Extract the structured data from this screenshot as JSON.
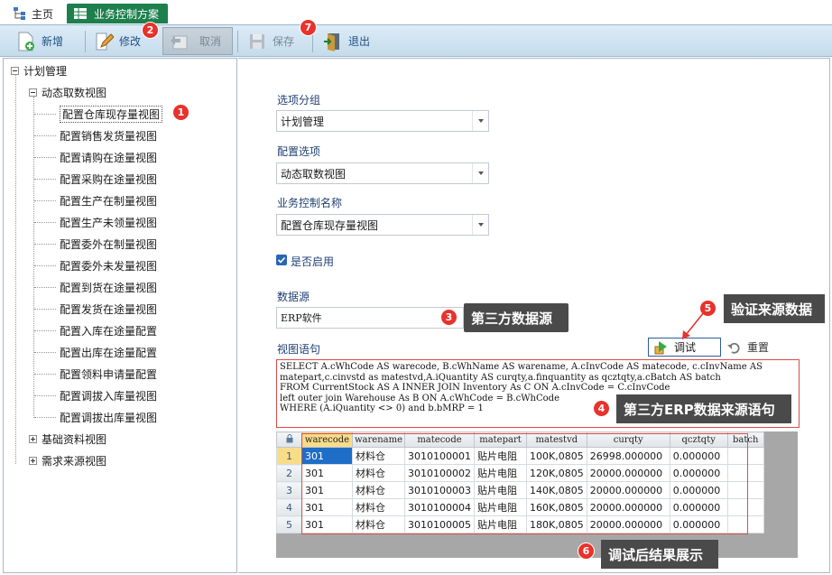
{
  "tabs": [
    {
      "label": "主页",
      "icon": "sitemap-icon"
    },
    {
      "label": "业务控制方案",
      "icon": "table-icon"
    }
  ],
  "toolbar": {
    "add": "新增",
    "edit": "修改",
    "cancel": "取消",
    "save": "保存",
    "exit": "退出"
  },
  "tree": {
    "root": "计划管理",
    "group": "动态取数视图",
    "items": [
      "配置仓库现存量视图",
      "配置销售发货量视图",
      "配置请购在途量视图",
      "配置采购在途量视图",
      "配置生产在制量视图",
      "配置生产未领量视图",
      "配置委外在制量视图",
      "配置委外未发量视图",
      "配置到货在途量视图",
      "配置发货在途量视图",
      "配置入库在途量配置",
      "配置出库在途量配置",
      "配置领料申请量配置",
      "配置调拔入库量视图",
      "配置调拔出库量视图"
    ],
    "others": [
      "基础资料视图",
      "需求来源视图"
    ]
  },
  "form": {
    "option_group_label": "选项分组",
    "option_group_value": "计划管理",
    "config_option_label": "配置选项",
    "config_option_value": "动态取数视图",
    "biz_name_label": "业务控制名称",
    "biz_name_value": "配置仓库现存量视图",
    "enabled_label": "是否启用",
    "datasource_label": "数据源",
    "datasource_value": "ERP软件",
    "view_sql_label": "视图语句",
    "debug_label": "调试",
    "reset_label": "重置"
  },
  "sql": "SELECT A.cWhCode AS warecode, B.cWhName AS warename, A.cInvCode AS matecode, c.cInvName AS\nmatepart,c.cinvstd as matestvd,A.iQuantity AS curqty,a.finquantity as qcztqty,a.cBatch AS batch\nFROM CurrentStock AS A INNER JOIN Inventory As C ON A.cInvCode = C.cInvCode\nleft outer join Warehouse As B ON A.cWhCode = B.cWhCode\nWHERE (A.iQuantity <> 0) and b.bMRP = 1",
  "grid": {
    "columns": [
      "warecode",
      "warename",
      "matecode",
      "matepart",
      "matestvd",
      "curqty",
      "qcztqty",
      "batch"
    ],
    "rows": [
      [
        "1",
        "301",
        "材料仓",
        "3010100001",
        "贴片电阻",
        "100K,0805",
        "26998.000000",
        "0.000000",
        ""
      ],
      [
        "2",
        "301",
        "材料仓",
        "3010100002",
        "贴片电阻",
        "120K,0805",
        "20000.000000",
        "0.000000",
        ""
      ],
      [
        "3",
        "301",
        "材料仓",
        "3010100003",
        "贴片电阻",
        "140K,0805",
        "20000.000000",
        "0.000000",
        ""
      ],
      [
        "4",
        "301",
        "材料仓",
        "3010100004",
        "贴片电阻",
        "160K,0805",
        "20000.000000",
        "0.000000",
        ""
      ],
      [
        "5",
        "301",
        "材料仓",
        "3010100005",
        "贴片电阻",
        "180K,0805",
        "20000.000000",
        "0.000000",
        ""
      ]
    ]
  },
  "annotations": {
    "b1": "1",
    "b2": "2",
    "b3": "3",
    "b4": "4",
    "b5": "5",
    "b6": "6",
    "b7": "7",
    "c3": "第三方数据源",
    "c4": "第三方ERP数据来源语句",
    "c5": "验证来源数据",
    "c6": "调试后结果展示"
  },
  "colors": {
    "active_tab": "#1d7f4c",
    "badge": "#e8322c",
    "callout": "#4a4a4a",
    "selection": "#1e6ec8"
  }
}
